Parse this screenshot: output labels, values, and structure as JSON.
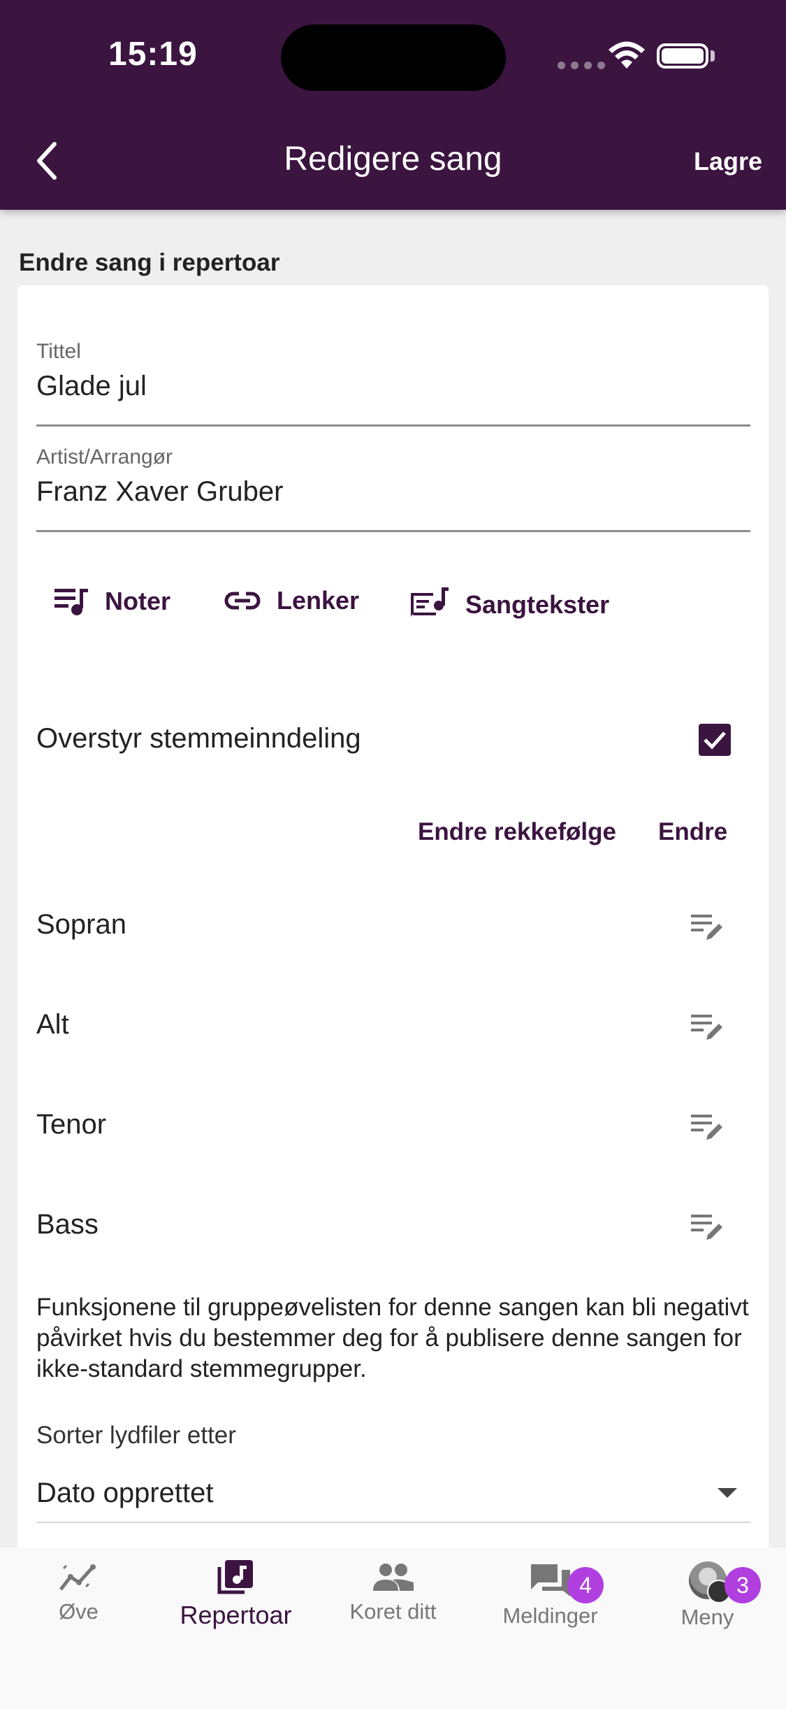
{
  "status_bar": {
    "time": "15:19"
  },
  "header": {
    "title": "Redigere sang",
    "save_label": "Lagre"
  },
  "section_label": "Endre sang i repertoar",
  "fields": [
    {
      "label": "Tittel",
      "value": "Glade jul"
    },
    {
      "label": "Artist/Arrangør",
      "value": "Franz Xaver Gruber"
    }
  ],
  "attachments": [
    {
      "label": "Noter",
      "icon": "sheet-music-icon"
    },
    {
      "label": "Lenker",
      "icon": "link-icon"
    },
    {
      "label": "Sangtekster",
      "icon": "lyrics-icon"
    }
  ],
  "override": {
    "label": "Overstyr stemmeinndeling",
    "checked": true
  },
  "voice_actions": {
    "reorder_label": "Endre rekkefølge",
    "edit_label": "Endre"
  },
  "voices": [
    "Sopran",
    "Alt",
    "Tenor",
    "Bass"
  ],
  "note": "Funksjonene til gruppeøvelisten for denne sangen kan bli negativt påvirket hvis du bestemmer deg for å publisere denne sangen for ikke-standard stemmegrupper.",
  "sort": {
    "label": "Sorter lydfiler etter",
    "value": "Dato opprettet"
  },
  "tabs": [
    {
      "label": "Øve",
      "icon": "practice-icon",
      "active": false
    },
    {
      "label": "Repertoar",
      "icon": "repertoire-icon",
      "active": true
    },
    {
      "label": "Koret ditt",
      "icon": "choir-icon",
      "active": false
    },
    {
      "label": "Meldinger",
      "icon": "messages-icon",
      "badge": "4",
      "active": false
    },
    {
      "label": "Meny",
      "icon": "avatar-icon",
      "badge": "3",
      "active": false
    }
  ],
  "colors": {
    "primary": "#3b1440",
    "badge": "#b13fe0",
    "background": "#efeff0"
  }
}
